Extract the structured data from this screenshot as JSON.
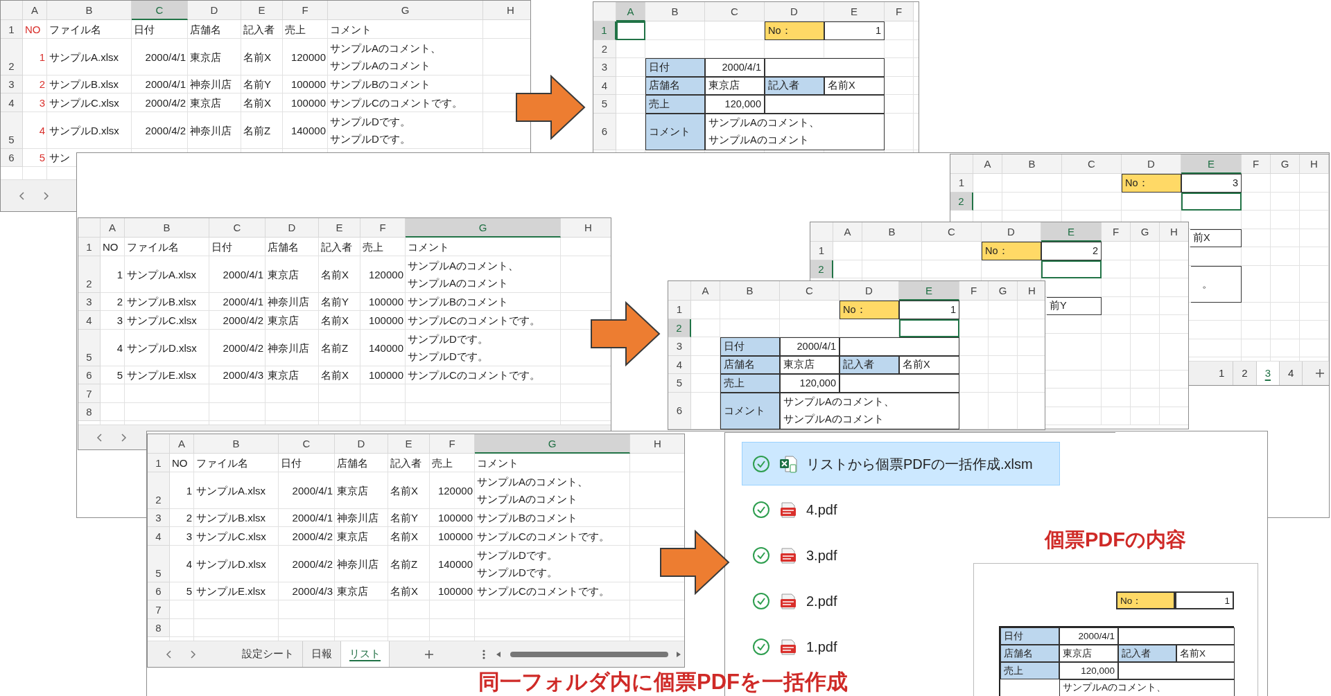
{
  "list_sheets": [
    {
      "columns": [
        {
          "letter": "A",
          "selected": false
        },
        {
          "letter": "B",
          "selected": false
        },
        {
          "letter": "C",
          "selected": true
        },
        {
          "letter": "D",
          "selected": false
        },
        {
          "letter": "E",
          "selected": false
        },
        {
          "letter": "F",
          "selected": false
        },
        {
          "letter": "G",
          "selected": false
        },
        {
          "letter": "H",
          "selected": false
        }
      ],
      "numbers_marked": true,
      "row_numbers": [
        "1",
        "2",
        "3",
        "4",
        "5",
        "6"
      ],
      "header": [
        "NO",
        "ファイル名",
        "日付",
        "店舗名",
        "記入者",
        "売上",
        "コメント"
      ],
      "records": [
        {
          "no": "1",
          "file": "サンプルA.xlsx",
          "date": "2000/4/1",
          "store": "東京店",
          "writer": "名前X",
          "sales": "120000",
          "comment": [
            "サンプルAのコメント、",
            "サンプルAのコメント"
          ]
        },
        {
          "no": "2",
          "file": "サンプルB.xlsx",
          "date": "2000/4/1",
          "store": "神奈川店",
          "writer": "名前Y",
          "sales": "100000",
          "comment": [
            "サンプルBのコメント"
          ]
        },
        {
          "no": "3",
          "file": "サンプルC.xlsx",
          "date": "2000/4/2",
          "store": "東京店",
          "writer": "名前X",
          "sales": "100000",
          "comment": [
            "サンプルCのコメントです。"
          ]
        },
        {
          "no": "4",
          "file": "サンプルD.xlsx",
          "date": "2000/4/2",
          "store": "神奈川店",
          "writer": "名前Z",
          "sales": "140000",
          "comment": [
            "サンプルDです。",
            "サンプルDです。"
          ]
        },
        {
          "no": "5",
          "file": "サン"
        }
      ]
    },
    {
      "columns": [
        {
          "letter": "A",
          "selected": false
        },
        {
          "letter": "B",
          "selected": false
        },
        {
          "letter": "C",
          "selected": false
        },
        {
          "letter": "D",
          "selected": false
        },
        {
          "letter": "E",
          "selected": false
        },
        {
          "letter": "F",
          "selected": false
        },
        {
          "letter": "G",
          "selected": true
        },
        {
          "letter": "H",
          "selected": false
        }
      ],
      "numbers_marked": false,
      "row_numbers": [
        "1",
        "2",
        "3",
        "4",
        "5",
        "6",
        "7",
        "8"
      ],
      "header": [
        "NO",
        "ファイル名",
        "日付",
        "店舗名",
        "記入者",
        "売上",
        "コメント"
      ],
      "records": [
        {
          "no": "1",
          "file": "サンプルA.xlsx",
          "date": "2000/4/1",
          "store": "東京店",
          "writer": "名前X",
          "sales": "120000",
          "comment": [
            "サンプルAのコメント、",
            "サンプルAのコメント"
          ]
        },
        {
          "no": "2",
          "file": "サンプルB.xlsx",
          "date": "2000/4/1",
          "store": "神奈川店",
          "writer": "名前Y",
          "sales": "100000",
          "comment": [
            "サンプルBのコメント"
          ]
        },
        {
          "no": "3",
          "file": "サンプルC.xlsx",
          "date": "2000/4/2",
          "store": "東京店",
          "writer": "名前X",
          "sales": "100000",
          "comment": [
            "サンプルCのコメントです。"
          ]
        },
        {
          "no": "4",
          "file": "サンプルD.xlsx",
          "date": "2000/4/2",
          "store": "神奈川店",
          "writer": "名前Z",
          "sales": "140000",
          "comment": [
            "サンプルDです。",
            "サンプルDです。"
          ]
        },
        {
          "no": "5",
          "file": "サンプルE.xlsx",
          "date": "2000/4/3",
          "store": "東京店",
          "writer": "名前X",
          "sales": "100000",
          "comment": [
            "サンプルCのコメントです。"
          ]
        }
      ]
    },
    {
      "columns": [
        {
          "letter": "A",
          "selected": false
        },
        {
          "letter": "B",
          "selected": false
        },
        {
          "letter": "C",
          "selected": false
        },
        {
          "letter": "D",
          "selected": false
        },
        {
          "letter": "E",
          "selected": false
        },
        {
          "letter": "F",
          "selected": false
        },
        {
          "letter": "G",
          "selected": true
        },
        {
          "letter": "H",
          "selected": false
        }
      ],
      "numbers_marked": false,
      "row_numbers": [
        "1",
        "2",
        "3",
        "4",
        "5",
        "6",
        "7",
        "8"
      ],
      "header": [
        "NO",
        "ファイル名",
        "日付",
        "店舗名",
        "記入者",
        "売上",
        "コメント"
      ],
      "records": [
        {
          "no": "1",
          "file": "サンプルA.xlsx",
          "date": "2000/4/1",
          "store": "東京店",
          "writer": "名前X",
          "sales": "120000",
          "comment": [
            "サンプルAのコメント、",
            "サンプルAのコメント"
          ]
        },
        {
          "no": "2",
          "file": "サンプルB.xlsx",
          "date": "2000/4/1",
          "store": "神奈川店",
          "writer": "名前Y",
          "sales": "100000",
          "comment": [
            "サンプルBのコメント"
          ]
        },
        {
          "no": "3",
          "file": "サンプルC.xlsx",
          "date": "2000/4/2",
          "store": "東京店",
          "writer": "名前X",
          "sales": "100000",
          "comment": [
            "サンプルCのコメントです。"
          ]
        },
        {
          "no": "4",
          "file": "サンプルD.xlsx",
          "date": "2000/4/2",
          "store": "神奈川店",
          "writer": "名前Z",
          "sales": "140000",
          "comment": [
            "サンプルDです。",
            "サンプルDです。"
          ]
        },
        {
          "no": "5",
          "file": "サンプルE.xlsx",
          "date": "2000/4/3",
          "store": "東京店",
          "writer": "名前X",
          "sales": "100000",
          "comment": [
            "サンプルCのコメントです。"
          ]
        }
      ],
      "tabs": [
        {
          "label": "設定シート",
          "selected": false
        },
        {
          "label": "日報",
          "selected": false
        },
        {
          "label": "リスト",
          "selected": true
        }
      ]
    }
  ],
  "form_sheets": [
    {
      "columns": [
        {
          "letter": "A",
          "selected": true
        },
        {
          "letter": "B",
          "selected": false
        },
        {
          "letter": "C",
          "selected": false
        },
        {
          "letter": "D",
          "selected": false
        },
        {
          "letter": "E",
          "selected": false
        },
        {
          "letter": "F",
          "selected": false
        }
      ],
      "rows": [
        {
          "num": "1",
          "selected": true
        },
        {
          "num": "2",
          "selected": false
        },
        {
          "num": "3",
          "selected": false
        },
        {
          "num": "4",
          "selected": false
        },
        {
          "num": "5",
          "selected": false
        },
        {
          "num": "6",
          "selected": false
        }
      ],
      "no_label": "No：",
      "no_value": "1",
      "date_label": "日付",
      "date": "2000/4/1",
      "store_label": "店舗名",
      "store": "東京店",
      "writer_label": "記入者",
      "writer": "名前X",
      "sales_label": "売上",
      "sales": "120,000",
      "comment_label": "コメント",
      "comment": [
        "サンプルAのコメント、",
        "サンプルAのコメント"
      ]
    },
    {
      "columns": [
        {
          "letter": "A",
          "selected": false
        },
        {
          "letter": "B",
          "selected": false
        },
        {
          "letter": "C",
          "selected": false
        },
        {
          "letter": "D",
          "selected": false
        },
        {
          "letter": "E",
          "selected": true
        },
        {
          "letter": "F",
          "selected": false
        },
        {
          "letter": "G",
          "selected": false
        },
        {
          "letter": "H",
          "selected": false
        }
      ],
      "rows": [
        {
          "num": "1",
          "selected": false
        },
        {
          "num": "2",
          "selected": true
        }
      ],
      "no_label": "No：",
      "no_value": "3",
      "writer": "前X",
      "comment": [
        "。"
      ],
      "tabs": [
        {
          "label": "1",
          "selected": false
        },
        {
          "label": "2",
          "selected": false
        },
        {
          "label": "3",
          "selected": true
        },
        {
          "label": "4",
          "selected": false
        }
      ]
    },
    {
      "columns": [
        {
          "letter": "A",
          "selected": false
        },
        {
          "letter": "B",
          "selected": false
        },
        {
          "letter": "C",
          "selected": false
        },
        {
          "letter": "D",
          "selected": false
        },
        {
          "letter": "E",
          "selected": true
        },
        {
          "letter": "F",
          "selected": false
        },
        {
          "letter": "G",
          "selected": false
        },
        {
          "letter": "H",
          "selected": false
        }
      ],
      "rows": [
        {
          "num": "1",
          "selected": false
        },
        {
          "num": "2",
          "selected": true
        }
      ],
      "no_label": "No：",
      "no_value": "2",
      "writer": "前Y"
    },
    {
      "columns": [
        {
          "letter": "A",
          "selected": false
        },
        {
          "letter": "B",
          "selected": false
        },
        {
          "letter": "C",
          "selected": false
        },
        {
          "letter": "D",
          "selected": false
        },
        {
          "letter": "E",
          "selected": true
        },
        {
          "letter": "F",
          "selected": false
        },
        {
          "letter": "G",
          "selected": false
        },
        {
          "letter": "H",
          "selected": false
        }
      ],
      "rows": [
        {
          "num": "1",
          "selected": false
        },
        {
          "num": "2",
          "selected": true
        },
        {
          "num": "3",
          "selected": false
        },
        {
          "num": "4",
          "selected": false
        },
        {
          "num": "5",
          "selected": false
        },
        {
          "num": "6",
          "selected": false
        }
      ],
      "no_label": "No：",
      "no_value": "1",
      "date_label": "日付",
      "date": "2000/4/1",
      "store_label": "店舗名",
      "store": "東京店",
      "writer_label": "記入者",
      "writer": "名前X",
      "sales_label": "売上",
      "sales": "120,000",
      "comment_label": "コメント",
      "comment": [
        "サンプルAのコメント、",
        "サンプルAのコメント"
      ]
    }
  ],
  "files": [
    {
      "name": "リストから個票PDFの一括作成.xlsm",
      "kind": "excel",
      "selected": true,
      "synced": true
    },
    {
      "name": "4.pdf",
      "kind": "pdf",
      "selected": false,
      "synced": true
    },
    {
      "name": "3.pdf",
      "kind": "pdf",
      "selected": false,
      "synced": true
    },
    {
      "name": "2.pdf",
      "kind": "pdf",
      "selected": false,
      "synced": true
    },
    {
      "name": "1.pdf",
      "kind": "pdf",
      "selected": false,
      "synced": true
    }
  ],
  "pdf_preview": {
    "no_label": "No：",
    "no_value": "1",
    "date_label": "日付",
    "date": "2000/4/1",
    "store_label": "店舗名",
    "store": "東京店",
    "writer_label": "記入者",
    "writer": "名前X",
    "sales_label": "売上",
    "sales": "120,000",
    "comment": [
      "サンプルAのコメント、"
    ]
  },
  "captions": [
    {
      "text": "同一フォルダ内に個票PDFを一括作成"
    },
    {
      "text": "個票PDFの内容"
    }
  ]
}
